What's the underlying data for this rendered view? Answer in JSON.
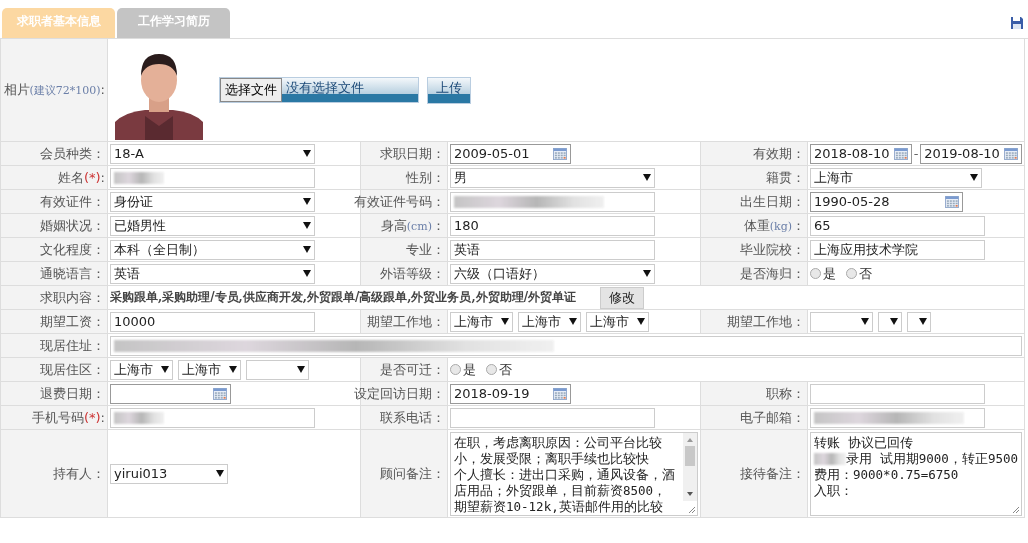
{
  "tabs": [
    {
      "label": "求职者基本信息",
      "selected": true
    },
    {
      "label": "工作学习简历",
      "selected": false
    }
  ],
  "rows": [
    {
      "cells": [
        {
          "kind": "label",
          "parts": [
            {
              "text": "相片"
            },
            {
              "text": "(建议72*100)",
              "kind": "unit"
            },
            {
              "text": ":"
            }
          ]
        },
        {
          "choose": "选择文件",
          "status": "没有选择文件",
          "upload": "上传"
        }
      ]
    },
    {
      "cells": [
        {
          "kind": "label",
          "text": "会员种类："
        },
        {
          "kind": "select",
          "value": "18-A"
        },
        {
          "kind": "label",
          "text": "求职日期："
        },
        {
          "kind": "date",
          "value": "2009-05-01"
        },
        {
          "kind": "label",
          "text": "有效期："
        },
        {
          "kind": "daterange",
          "from": "2018-08-10",
          "separator": "-",
          "to": "2019-08-10"
        }
      ]
    },
    {
      "cells": [
        {
          "kind": "label",
          "parts": [
            {
              "text": "姓名"
            },
            {
              "text": "(*)",
              "kind": "required"
            },
            {
              "text": ":"
            }
          ]
        },
        {
          "kind": "redacted"
        },
        {
          "kind": "label",
          "text": "性别："
        },
        {
          "kind": "select",
          "value": "男"
        },
        {
          "kind": "label",
          "text": "籍贯："
        },
        {
          "kind": "select",
          "value": "上海市"
        }
      ]
    },
    {
      "cells": [
        {
          "kind": "label",
          "text": "有效证件："
        },
        {
          "kind": "select",
          "value": "身份证"
        },
        {
          "kind": "label",
          "text": "有效证件号码："
        },
        {
          "kind": "redacted"
        },
        {
          "kind": "label",
          "text": "出生日期："
        },
        {
          "kind": "date",
          "value": "1990-05-28"
        }
      ]
    },
    {
      "cells": [
        {
          "kind": "label",
          "text": "婚姻状况："
        },
        {
          "kind": "select",
          "value": "已婚男性"
        },
        {
          "kind": "label",
          "parts": [
            {
              "text": "身高"
            },
            {
              "text": "(cm)",
              "kind": "unit"
            },
            {
              "text": "："
            }
          ]
        },
        {
          "kind": "text",
          "value": "180"
        },
        {
          "kind": "label",
          "parts": [
            {
              "text": "体重"
            },
            {
              "text": "(kg)",
              "kind": "unit"
            },
            {
              "text": "："
            }
          ]
        },
        {
          "kind": "text",
          "value": "65"
        }
      ]
    },
    {
      "cells": [
        {
          "kind": "label",
          "text": "文化程度："
        },
        {
          "kind": "select",
          "value": "本科（全日制）"
        },
        {
          "kind": "label",
          "text": "专业："
        },
        {
          "kind": "text",
          "value": "英语"
        },
        {
          "kind": "label",
          "text": "毕业院校："
        },
        {
          "kind": "text",
          "value": "上海应用技术学院"
        }
      ]
    },
    {
      "cells": [
        {
          "kind": "label",
          "text": "通晓语言："
        },
        {
          "kind": "select",
          "value": "英语"
        },
        {
          "kind": "label",
          "text": "外语等级："
        },
        {
          "kind": "select",
          "value": "六级（口语好）"
        },
        {
          "kind": "label",
          "text": "是否海归："
        },
        {
          "kind": "radio",
          "options": [
            {
              "text": "是",
              "selected": false
            },
            {
              "text": "否",
              "selected": false
            }
          ]
        }
      ]
    },
    {
      "cells": [
        {
          "kind": "label",
          "text": "求职内容："
        },
        {
          "kind": "tags",
          "value": "采购跟单,采购助理/专员,供应商开发,外贸跟单/高级跟单,外贸业务员,外贸助理/外贸单证",
          "button": "修改"
        }
      ]
    },
    {
      "cells": [
        {
          "kind": "label",
          "text": "期望工资："
        },
        {
          "kind": "text",
          "value": "10000"
        },
        {
          "kind": "label",
          "text": "期望工作地："
        },
        {
          "kind": "selectgroup",
          "selects": [
            {
              "kind": "city",
              "value": "上海市"
            },
            {
              "kind": "city",
              "value": "上海市"
            },
            {
              "kind": "city",
              "value": "上海市"
            }
          ]
        },
        {
          "kind": "label",
          "text": "期望工作地："
        },
        {
          "kind": "selectgroup",
          "selects": [
            {
              "kind": "blank"
            },
            {
              "kind": "blank"
            },
            {
              "kind": "blank"
            }
          ]
        }
      ]
    },
    {
      "cells": [
        {
          "kind": "label",
          "text": "现居住址："
        },
        {
          "kind": "redacted"
        }
      ]
    },
    {
      "cells": [
        {
          "kind": "label",
          "text": "现居住区："
        },
        {
          "kind": "selectgroup",
          "selects": [
            {
              "kind": "city",
              "value": "上海市"
            },
            {
              "kind": "city",
              "value": "上海市"
            },
            {
              "kind": "blank"
            }
          ]
        },
        {
          "kind": "label",
          "text": "是否可迁："
        },
        {
          "kind": "radio",
          "options": [
            {
              "text": "是",
              "selected": false
            },
            {
              "text": "否",
              "selected": false
            }
          ]
        }
      ]
    },
    {
      "cells": [
        {
          "kind": "label",
          "text": "退费日期："
        },
        {
          "kind": "date"
        },
        {
          "kind": "label",
          "text": "设定回访日期："
        },
        {
          "kind": "date",
          "value": "2018-09-19"
        },
        {
          "kind": "label",
          "text": "职称："
        },
        {
          "kind": "text"
        }
      ]
    },
    {
      "cells": [
        {
          "kind": "label",
          "parts": [
            {
              "text": "手机号码"
            },
            {
              "text": "(*)",
              "kind": "required"
            },
            {
              "text": ":"
            }
          ]
        },
        {
          "kind": "redacted"
        },
        {
          "kind": "label",
          "text": "联系电话："
        },
        {
          "kind": "text"
        },
        {
          "kind": "label",
          "text": "电子邮箱："
        },
        {
          "kind": "redacted"
        }
      ]
    },
    {
      "cells": [
        {
          "kind": "label",
          "text": "持有人："
        },
        {
          "kind": "select",
          "value": "yirui013",
          "compact": true
        },
        {
          "kind": "label",
          "text": "顾问备注："
        },
        {
          "kind": "textarea",
          "scroll": true,
          "lines": [
            {
              "text": "在职，考虑离职原因：公司平台比较"
            },
            {
              "text": "小，发展受限；离职手续也比较快"
            },
            {
              "text": "个人擅长：进出口采购，通风设备，酒"
            },
            {
              "text": "店用品；外贸跟单，目前薪资8500，"
            },
            {
              "text": "期望薪资10-12k,英语邮件用的比较"
            }
          ]
        },
        {
          "kind": "label",
          "text": "接待备注："
        },
        {
          "kind": "textarea",
          "scroll": false,
          "lines": [
            {
              "text": "转账  协议已回传"
            },
            {
              "text": "录用  试用期9000，转正9500",
              "redacted": true
            },
            {
              "text": "费用：9000*0.75=6750"
            },
            {
              "text": "入职："
            }
          ]
        }
      ]
    }
  ]
}
